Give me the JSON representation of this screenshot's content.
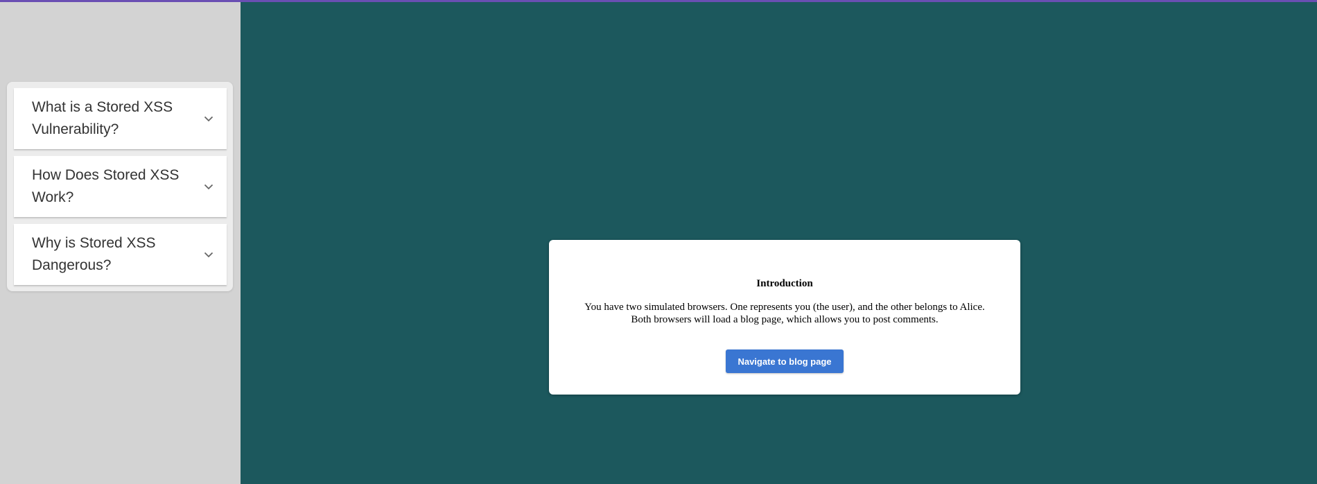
{
  "colors": {
    "top_bar": "#6a4fb3",
    "sidebar_bg": "#d3d3d3",
    "main_bg": "#1c585d",
    "card_bg": "#ffffff",
    "button_bg": "#3a76d2",
    "chevron": "#666666"
  },
  "sidebar": {
    "items": [
      {
        "label": "What is a Stored XSS Vulnerability?",
        "icon": "chevron-down-icon",
        "expanded": false
      },
      {
        "label": "How Does Stored XSS Work?",
        "icon": "chevron-down-icon",
        "expanded": false
      },
      {
        "label": "Why is Stored XSS Dangerous?",
        "icon": "chevron-down-icon",
        "expanded": false
      }
    ]
  },
  "intro": {
    "title": "Introduction",
    "line1": "You have two simulated browsers. One represents you (the user), and the other belongs to Alice.",
    "line2": "Both browsers will load a blog page, which allows you to post comments.",
    "button_label": "Navigate to blog page"
  }
}
